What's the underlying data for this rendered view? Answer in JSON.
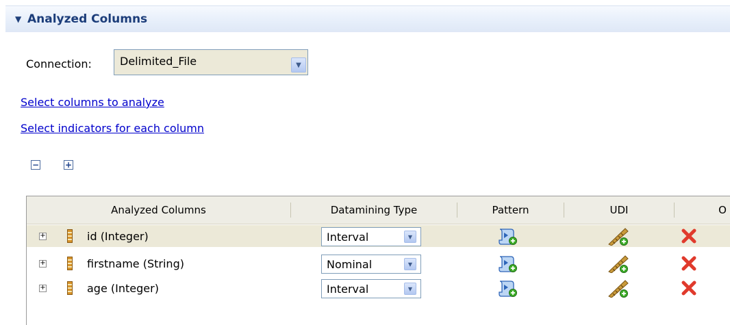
{
  "section": {
    "title": "Analyzed Columns"
  },
  "connection": {
    "label": "Connection:",
    "value": "Delimited_File"
  },
  "links": {
    "select_columns": "Select columns to analyze",
    "select_indicators": "Select indicators for each column"
  },
  "toolbar": {
    "collapse_icon": "collapse-all-icon",
    "expand_icon": "expand-all-icon"
  },
  "table": {
    "headers": [
      "Analyzed Columns",
      "Datamining Type",
      "Pattern",
      "UDI",
      "O"
    ],
    "rows": [
      {
        "column": "id (Integer)",
        "datamining_type": "Interval"
      },
      {
        "column": "firstname (String)",
        "datamining_type": "Nominal"
      },
      {
        "column": "age (Integer)",
        "datamining_type": "Interval"
      }
    ],
    "icons": {
      "column": "column-icon",
      "pattern": "add-pattern-icon",
      "udi": "add-udi-icon",
      "operation": "delete-icon"
    }
  },
  "colors": {
    "header_text": "#1c3d7a",
    "link": "#0000cc",
    "selected_row": "#ece9d8",
    "delete": "#e03a2c"
  }
}
